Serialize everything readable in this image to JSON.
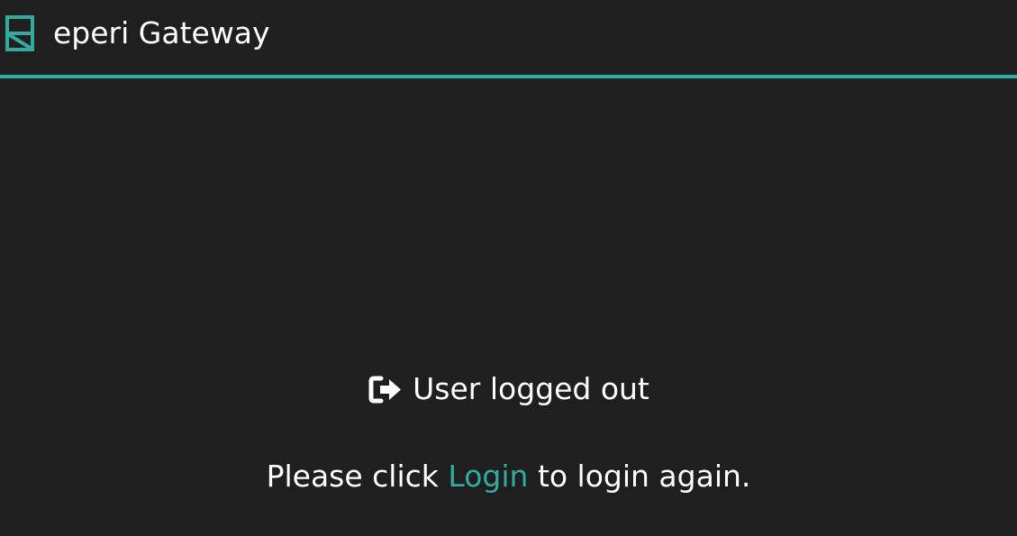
{
  "header": {
    "brand_icon": "gateway-logo-icon",
    "title": "eperi Gateway",
    "accent_color": "#33aaa0",
    "background_color": "#1f1f1f"
  },
  "status": {
    "icon": "sign-out-icon",
    "text": "User logged out"
  },
  "message": {
    "before_link": "Please click",
    "link_text": "Login",
    "after_link": "to login again."
  }
}
